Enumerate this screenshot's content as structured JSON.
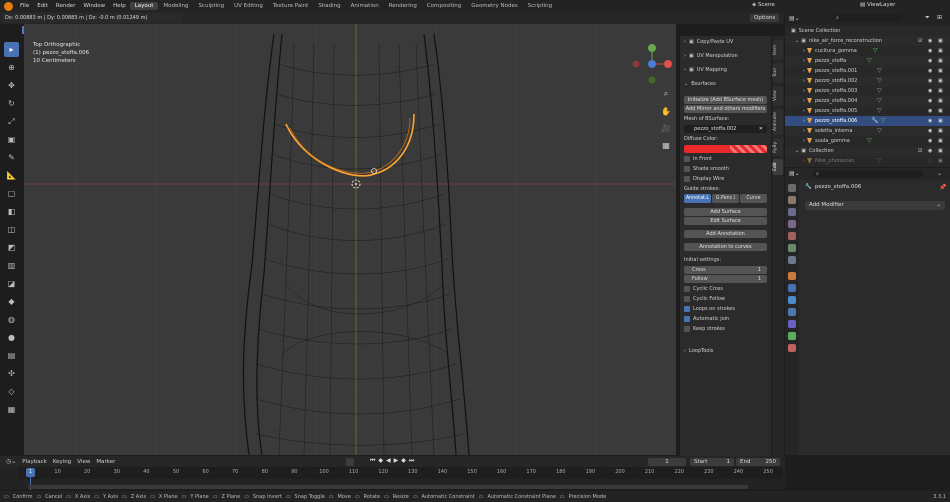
{
  "topbar": {
    "menus": [
      "File",
      "Edit",
      "Render",
      "Window",
      "Help"
    ],
    "workspaces": [
      "Layout",
      "Modeling",
      "Sculpting",
      "UV Editing",
      "Texture Paint",
      "Shading",
      "Animation",
      "Rendering",
      "Compositing",
      "Geometry Nodes",
      "Scripting"
    ],
    "active_workspace": "Layout",
    "scene_label": "Scene",
    "viewlayer_label": "ViewLayer"
  },
  "status_top": "Dx: 0.00883 m | Dy: 0.00883 m | Dz: -0.0 m (0.01249 m)",
  "viewport": {
    "options_label": "Options",
    "info_line1": "Top Orthographic",
    "info_line2": "(1) pezzo_stoffa.006",
    "info_line3": "10 Centimeters"
  },
  "npanel": {
    "tabs": [
      "Item",
      "Tool",
      "View",
      "Animate",
      "RyBy",
      "Edit"
    ],
    "sections": {
      "copy_paste_uv": "Copy/Paste UV",
      "uv_manipulation": "UV Manipulation",
      "uv_mapping": "UV Mapping",
      "bsurfaces": "Bsurfaces"
    },
    "btn_initialize": "Initialize (Add BSurface mesh)",
    "btn_add_mirror": "Add Mirror and others modifiers",
    "mesh_label": "Mesh of BSurface:",
    "mesh_value": "pezzo_stoffa.002",
    "diffuse_label": "Diffuse Color:",
    "in_front": "In Front",
    "shade_smooth": "Shade smooth",
    "display_wire": "Display Wire",
    "guide_strokes": "Guide strokes:",
    "guide_opts": [
      "Annotat.L",
      "G.Penc.l",
      "Curve"
    ],
    "btn_add_surface": "Add Surface",
    "btn_edit_surface": "Edit Surface",
    "btn_add_annotation": "Add Annotation",
    "btn_annotation_curves": "Annotation to curves",
    "initial_settings": "Initial settings:",
    "cross_label": "Cross",
    "cross_value": "1",
    "follow_label": "Follow",
    "follow_value": "1",
    "cyclic_cross": "Cyclic Cross",
    "cyclic_follow": "Cyclic Follow",
    "loops_on_strokes": "Loops on strokes",
    "automatic_join": "Automatic join",
    "keep_strokes": "Keep strokes",
    "looptools": "LoopTools"
  },
  "outliner": {
    "rows": [
      {
        "label": "Scene Collection",
        "indent": 0
      },
      {
        "label": "nike_air_force_reconstruction",
        "indent": 1
      },
      {
        "label": "cucitura_gomma",
        "indent": 2
      },
      {
        "label": "pezzo_stoffa",
        "indent": 2
      },
      {
        "label": "pezzo_stoffa.001",
        "indent": 2
      },
      {
        "label": "pezzo_stoffa.002",
        "indent": 2
      },
      {
        "label": "pezzo_stoffa.003",
        "indent": 2
      },
      {
        "label": "pezzo_stoffa.004",
        "indent": 2
      },
      {
        "label": "pezzo_stoffa.005",
        "indent": 2
      },
      {
        "label": "pezzo_stoffa.006",
        "indent": 2,
        "selected": true
      },
      {
        "label": "soletta_interna",
        "indent": 2
      },
      {
        "label": "suola_gomma",
        "indent": 2
      },
      {
        "label": "Collection",
        "indent": 1
      },
      {
        "label": "Nike_photoscan",
        "indent": 2,
        "dim": true
      }
    ]
  },
  "properties": {
    "object_name": "pezzo_stoffa.006",
    "add_modifier": "Add Modifier"
  },
  "timeline": {
    "menus": [
      "Playback",
      "Keying",
      "View",
      "Marker"
    ],
    "current_frame": "1",
    "start_label": "Start",
    "start_value": "1",
    "end_label": "End",
    "end_value": "250",
    "ticks": [
      "0",
      "10",
      "20",
      "30",
      "40",
      "50",
      "60",
      "70",
      "80",
      "90",
      "100",
      "110",
      "120",
      "130",
      "140",
      "150",
      "160",
      "170",
      "180",
      "190",
      "200",
      "210",
      "220",
      "230",
      "240",
      "250"
    ],
    "cursor_frame": "1"
  },
  "statusbar": {
    "items": [
      "Confirm",
      "Cancel",
      "X Axis",
      "Y Axis",
      "Z Axis",
      "X Plane",
      "Y Plane",
      "Z Plane",
      "Snap Invert",
      "Snap Toggle",
      "Move",
      "Rotate",
      "Resize",
      "Automatic Constraint",
      "Automatic Constraint Plane",
      "Precision Mode"
    ],
    "version": "3.3.1"
  },
  "colors": {
    "accent": "#4772b3",
    "selected_row": "#334d80",
    "diffuse": "#e82a2a",
    "selected_edge": "#ffa530",
    "frame_cursor": "#4772b3"
  }
}
